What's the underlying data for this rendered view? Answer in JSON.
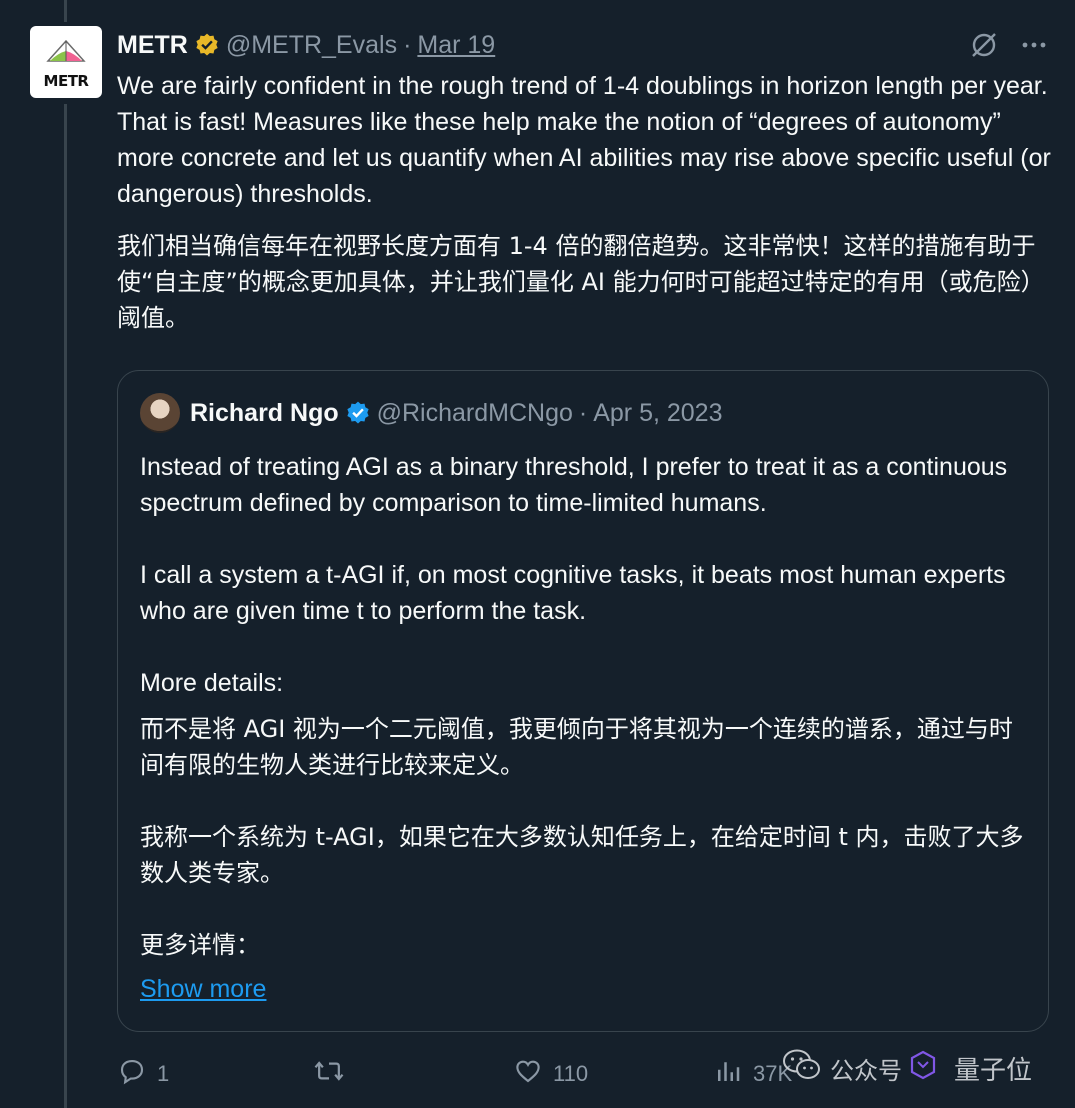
{
  "tweet": {
    "display_name": "METR",
    "handle": "@METR_Evals",
    "date": "Mar 19",
    "avatar_text": "METR",
    "text_en": "We are fairly confident in the rough trend of 1-4 doublings in horizon length per year. That is fast! Measures like these help make the notion of “degrees of autonomy” more concrete and let us quantify when AI abilities may rise above specific useful (or dangerous) thresholds.",
    "text_zh": "我们相当确信每年在视野长度方面有 1-4 倍的翻倍趋势。这非常快！这样的措施有助于使“自主度”的概念更加具体，并让我们量化 AI 能力何时可能超过特定的有用（或危险）阈值。"
  },
  "quote": {
    "display_name": "Richard Ngo",
    "handle": "@RichardMCNgo",
    "date": "Apr 5, 2023",
    "p1": "Instead of treating AGI as a binary threshold, I prefer to treat it as a continuous spectrum defined by comparison to time-limited humans.",
    "p2": "I call a system a t-AGI if, on most cognitive tasks, it beats most human experts who are given time t to perform the task.",
    "p3": "More details:",
    "zh1": "而不是将 AGI 视为一个二元阈值，我更倾向于将其视为一个连续的谱系，通过与时间有限的生物人类进行比较来定义。",
    "zh2": "我称一个系统为 t-AGI，如果它在大多数认知任务上，在给定时间 t 内，击败了大多数人类专家。",
    "zh3": "更多详情：",
    "show_more": "Show more"
  },
  "actions": {
    "replies": "1",
    "retweets": "",
    "likes": "110",
    "views": "37K"
  },
  "watermark": {
    "text": "公众号",
    "brand": "量子位"
  },
  "colors": {
    "background": "#15202b",
    "text": "#f7f9f9",
    "muted": "#8b98a5",
    "link": "#1d9bf0",
    "verified_gold": "#e8b828",
    "verified_blue": "#1d9bf0",
    "border": "#38444d"
  },
  "icons": [
    "metr-logo-icon",
    "verified-gold-icon",
    "grok-icon",
    "more-icon",
    "verified-blue-icon",
    "reply-icon",
    "retweet-icon",
    "like-icon",
    "views-icon",
    "wechat-icon",
    "watermark-logo-icon"
  ]
}
